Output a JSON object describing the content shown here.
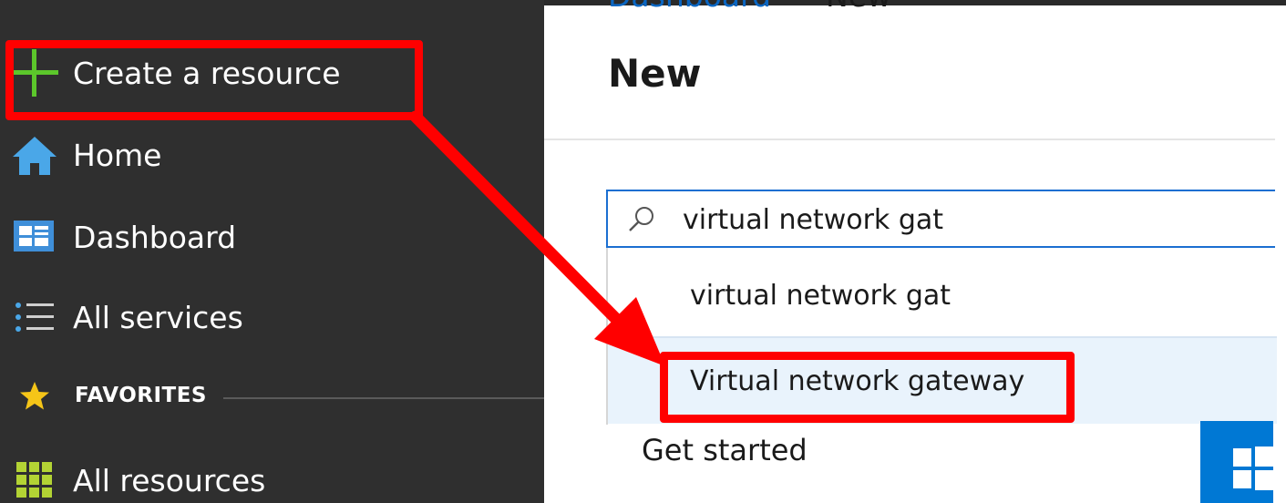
{
  "sidebar": {
    "items": [
      {
        "label": "Create a resource",
        "icon": "plus-icon"
      },
      {
        "label": "Home",
        "icon": "home-icon"
      },
      {
        "label": "Dashboard",
        "icon": "dashboard-icon"
      },
      {
        "label": "All services",
        "icon": "list-icon"
      },
      {
        "label": "All resources",
        "icon": "grid-icon"
      }
    ],
    "favorites": {
      "label": "FAVORITES",
      "icon": "star-icon"
    }
  },
  "main": {
    "breadcrumb": {
      "parent": "Dashboard",
      "current": "New"
    },
    "title": "New",
    "search": {
      "value": "virtual network gat",
      "icon": "search-icon"
    },
    "suggestions": [
      "virtual network gat",
      "Virtual network gateway"
    ],
    "get_started": "Get started"
  },
  "colors": {
    "sidebar_bg": "#2f2f2f",
    "accent": "#0078d4",
    "highlight": "#ff0000",
    "plus": "#5cc72b",
    "star": "#f5c518"
  }
}
